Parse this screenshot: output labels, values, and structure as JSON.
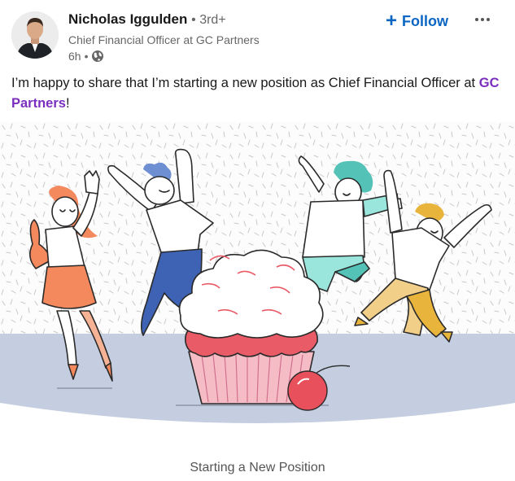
{
  "author": {
    "name": "Nicholas Iggulden",
    "degree": "• 3rd+",
    "headline": "Chief Financial Officer at GC Partners",
    "time": "6h",
    "separator": "•",
    "visibility_icon": "globe-icon",
    "avatar_icon": "profile-photo"
  },
  "actions": {
    "follow_plus": "+",
    "follow_label": "Follow",
    "more_icon": "more-options-icon"
  },
  "post": {
    "text_before": "I’m happy to share that I’m starting a new position as Chief Financial Officer at ",
    "mention": "GC Partners",
    "text_after": "!"
  },
  "illustration": {
    "subject": "celebration-illustration",
    "colors": {
      "ground": "#c5cee0",
      "cupcake_base": "#f6bcc6",
      "cupcake_top": "#e85b67",
      "cherry": "#e8505b",
      "woman_skirt": "#f4895e",
      "man_pants": "#3f63b4",
      "teal": "#9ae6dd",
      "mustard": "#e9b43c"
    }
  },
  "caption": "Starting a New Position",
  "colors": {
    "accent": "#0a66c2",
    "mention": "#7b2fbe"
  }
}
